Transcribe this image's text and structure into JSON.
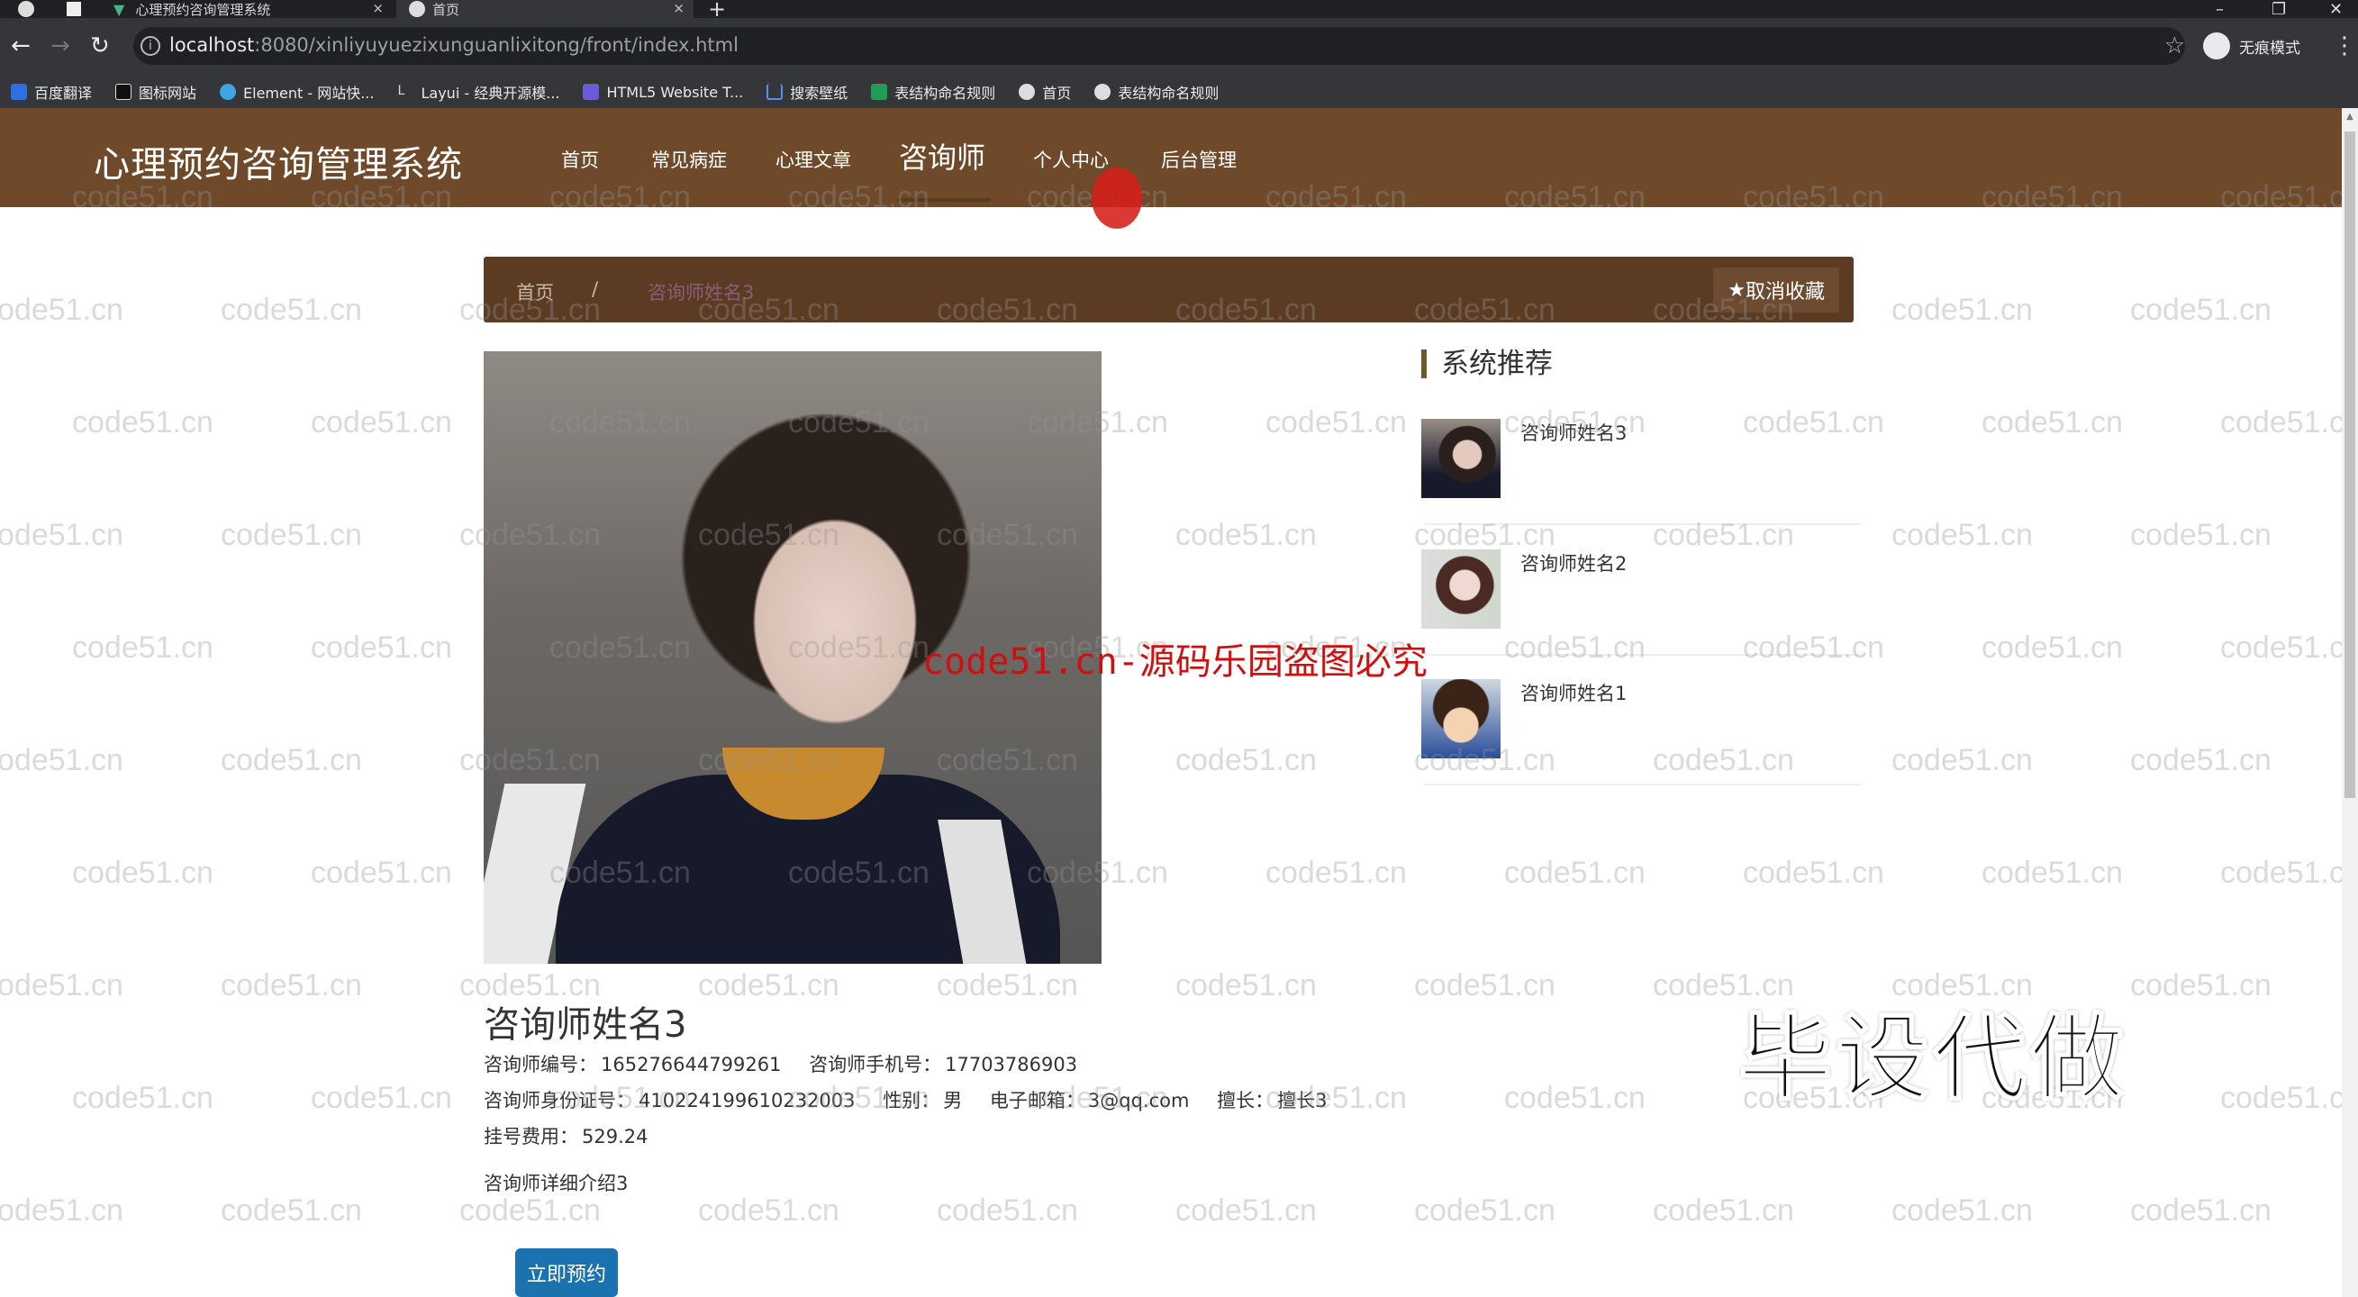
{
  "browser": {
    "tabs": [
      {
        "label": "心理预约咨询管理系统",
        "icon": "vue-icon",
        "close": "×"
      },
      {
        "label": "首页",
        "icon": "globe-icon",
        "close": "×"
      }
    ],
    "new_tab": "+",
    "window_controls": {
      "minimize": "–",
      "maximize": "❐",
      "close": "✕"
    },
    "nav": {
      "back": "←",
      "forward": "→",
      "reload": "↻"
    },
    "url_host": "localhost",
    "url_rest": ":8080/xinliyuyuezixunguanlixitong/front/index.html",
    "info_glyph": "i",
    "star_glyph": "☆",
    "incognito_label": "无痕模式",
    "menu_glyph": "⋮",
    "bookmarks": [
      {
        "label": "百度翻译",
        "icon": "translate-icon",
        "color": "#2f6fe4"
      },
      {
        "label": "图标网站",
        "icon": "flag-icon",
        "color": "#111111"
      },
      {
        "label": "Element - 网站快...",
        "icon": "element-icon",
        "color": "#3da5e0"
      },
      {
        "label": "Layui - 经典开源模...",
        "icon": "layui-icon",
        "color": "#35363a"
      },
      {
        "label": "HTML5 Website T...",
        "icon": "html5-icon",
        "color": "#6b5bd6"
      },
      {
        "label": "搜索壁纸",
        "icon": "wallpaper-icon",
        "color": "#3a6fd6"
      },
      {
        "label": "表结构命名规则",
        "icon": "sheet-icon",
        "color": "#1f9d55"
      },
      {
        "label": "首页",
        "icon": "globe-icon",
        "color": "#dddddd"
      },
      {
        "label": "表结构命名规则",
        "icon": "globe-icon",
        "color": "#dddddd"
      }
    ]
  },
  "header": {
    "site_title": "心理预约咨询管理系统",
    "nav": [
      {
        "label": "首页",
        "active": false
      },
      {
        "label": "常见病症",
        "active": false
      },
      {
        "label": "心理文章",
        "active": false
      },
      {
        "label": "咨询师",
        "active": true
      },
      {
        "label": "个人中心",
        "active": false
      },
      {
        "label": "后台管理",
        "active": false
      }
    ]
  },
  "breadcrumb": {
    "home": "首页",
    "separator": "/",
    "current": "咨询师姓名3",
    "favorite_button": "取消收藏",
    "favorite_icon": "★"
  },
  "counselor": {
    "name": "咨询师姓名3",
    "fields": {
      "id_label": "咨询师编号：",
      "id_value": "165276644799261",
      "phone_label": "咨询师手机号：",
      "phone_value": "17703786903",
      "idcard_label": "咨询师身份证号：",
      "idcard_value": "410224199610232003",
      "gender_label": "性别：",
      "gender_value": "男",
      "email_label": "电子邮箱：",
      "email_value": "3@qq.com",
      "specialty_label": "擅长：",
      "specialty_value": "擅长3",
      "fee_label": "挂号费用：",
      "fee_value": "529.24"
    },
    "description": "咨询师详细介绍3",
    "book_button": "立即预约"
  },
  "recommend": {
    "title": "系统推荐",
    "items": [
      {
        "name": "咨询师姓名3"
      },
      {
        "name": "咨询师姓名2"
      },
      {
        "name": "咨询师姓名1"
      }
    ]
  },
  "overlays": {
    "watermark": "code51.cn",
    "red_watermark": "code51.cn-源码乐园盗图必究",
    "promo": "毕设代做"
  },
  "colors": {
    "nav_bg": "#6e4a2a",
    "breadcrumb_bg": "#5c3b23",
    "book_button": "#1a73ae"
  }
}
